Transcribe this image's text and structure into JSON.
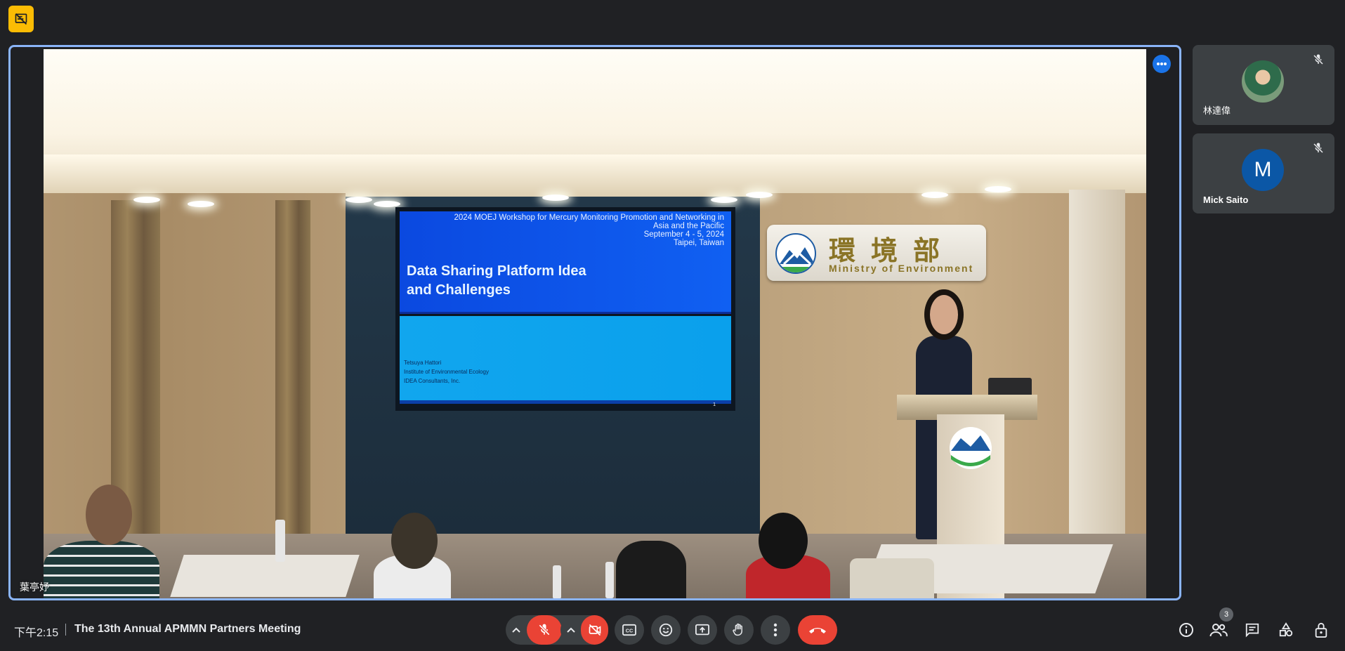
{
  "meeting": {
    "time": "下午2:15",
    "title": "The 13th Annual APMMN Partners Meeting",
    "participant_count": "3"
  },
  "stage": {
    "presenter_name": "葉亭妤"
  },
  "slide": {
    "header_line1": "2024 MOEJ Workshop for Mercury Monitoring Promotion and Networking in",
    "header_line2": "Asia and the Pacific",
    "date": "September 4 - 5, 2024",
    "place": "Taipei, Taiwan",
    "title_line1": "Data Sharing Platform Idea",
    "title_line2": "and Challenges",
    "author1": "Tetsuya Hattori",
    "author2": "Institute of Environmental Ecology",
    "author3": "IDEA Consultants, Inc.",
    "page": "1"
  },
  "sign": {
    "chinese": "環境部",
    "english": "Ministry of Environment"
  },
  "participants": [
    {
      "name": "林達偉",
      "avatar": "photo",
      "muted": true
    },
    {
      "name": "Mick Saito",
      "avatar_letter": "M",
      "muted": true
    }
  ],
  "colors": {
    "background": "#202124",
    "tile": "#3c4043",
    "accent_blue": "#8ab4f8",
    "danger_red": "#ea4335",
    "warning_yellow": "#fbbc04",
    "avatar_blue": "#0b57a6"
  },
  "icons": {
    "top_indicator": "no-recording-icon",
    "controls": [
      "mic-off-icon",
      "camera-off-icon",
      "captions-icon",
      "emoji-icon",
      "present-icon",
      "raise-hand-icon",
      "more-vert-icon",
      "end-call-icon"
    ],
    "right": [
      "info-icon",
      "people-icon",
      "chat-icon",
      "activities-icon",
      "host-controls-icon"
    ]
  }
}
